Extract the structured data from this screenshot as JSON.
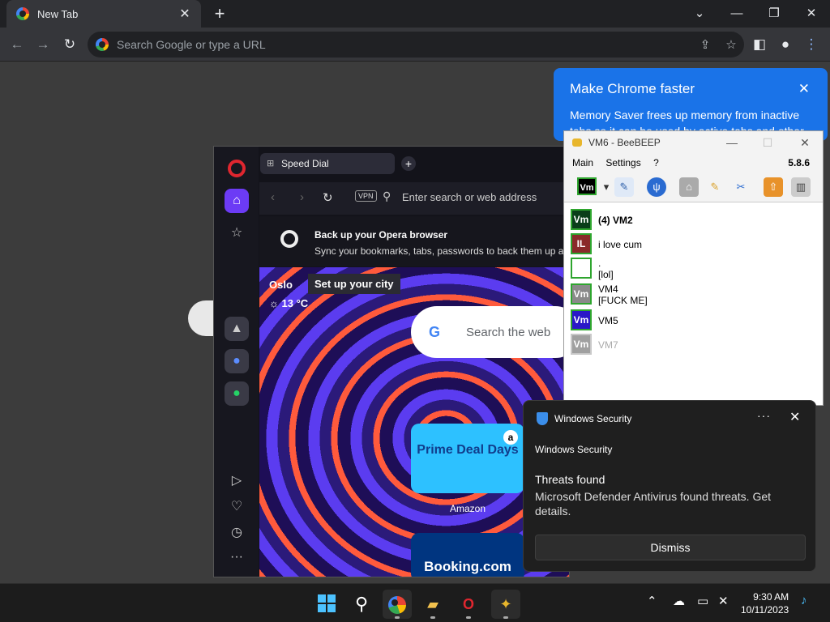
{
  "chrome": {
    "tab_title": "New Tab",
    "omnibox_placeholder": "Search Google or type a URL",
    "promo": {
      "title": "Make Chrome faster",
      "body": "Memory Saver frees up memory from inactive tabs so it can be used by active tabs and other"
    }
  },
  "opera": {
    "tab_title": "Speed Dial",
    "vpn_label": "VPN",
    "address_placeholder": "Enter search or web address",
    "sync_title": "Back up your Opera browser",
    "sync_body": "Sync your bookmarks, tabs, passwords to back them up an",
    "city": "Oslo",
    "temperature": "13 °C",
    "setup_city": "Set up your city",
    "web_search_placeholder": "Search the web",
    "tile_amazon_text": "Prime Deal Days",
    "tile_amazon_label": "Amazon",
    "tile_booking_text": "Booking.com"
  },
  "beebeep": {
    "title": "VM6 - BeeBEEP",
    "menu": [
      "Main",
      "Settings",
      "?"
    ],
    "version": "5.8.6",
    "users": [
      {
        "avatar": "Vm",
        "color": "#0a3d1a",
        "line1": "(4) VM2",
        "line2": "",
        "bold": true
      },
      {
        "avatar": "IL",
        "color": "#8a2a2a",
        "line1": "i love cum",
        "line2": ""
      },
      {
        "avatar": "",
        "color": "#ffffff",
        "line1": ".",
        "line2": "[lol]"
      },
      {
        "avatar": "Vm",
        "color": "#8a8a8a",
        "line1": "VM4",
        "line2": "[FUCK ME]"
      },
      {
        "avatar": "Vm",
        "color": "#2a18c8",
        "line1": "VM5",
        "line2": ""
      },
      {
        "avatar": "Vm",
        "color": "#a0a0a0",
        "line1": "VM7",
        "line2": "",
        "dim": true
      }
    ]
  },
  "toast": {
    "app_name": "Windows Security",
    "more": "···",
    "close": "✕",
    "source": "Windows Security",
    "headline": "Threats found",
    "message": "Microsoft Defender Antivirus found threats. Get details.",
    "dismiss": "Dismiss"
  },
  "taskbar": {
    "time": "9:30 AM",
    "date": "10/11/2023"
  }
}
